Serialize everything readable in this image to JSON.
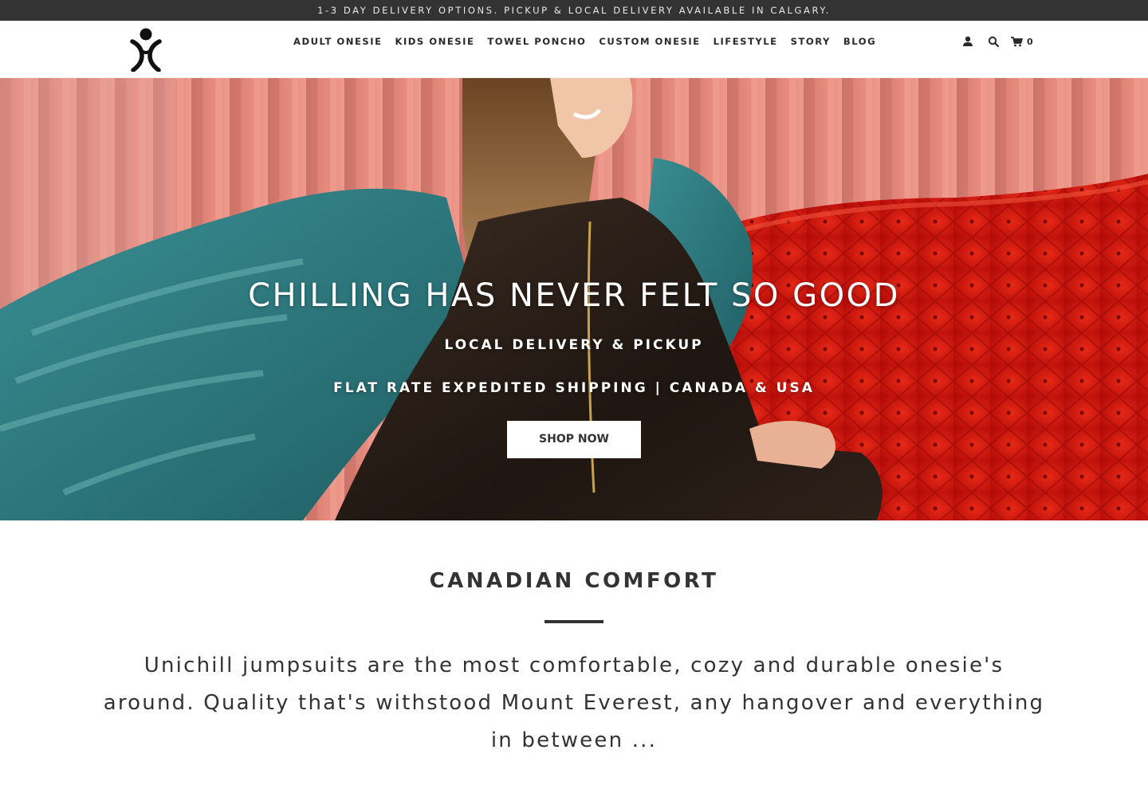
{
  "announcement": {
    "text": "1-3 DAY DELIVERY OPTIONS. PICKUP & LOCAL DELIVERY AVAILABLE IN CALGARY."
  },
  "header": {
    "logo_icon": "unichill-figure-logo",
    "nav": [
      {
        "label": "ADULT ONESIE"
      },
      {
        "label": "KIDS ONESIE"
      },
      {
        "label": "TOWEL PONCHO"
      },
      {
        "label": "CUSTOM ONESIE"
      },
      {
        "label": "LIFESTYLE"
      },
      {
        "label": "STORY"
      },
      {
        "label": "BLOG"
      }
    ],
    "icons": {
      "account": "user-icon",
      "search": "search-icon",
      "cart": "cart-icon"
    },
    "cart_count": "0"
  },
  "hero": {
    "title": "CHILLING HAS NEVER FELT SO GOOD",
    "subtitle_1": "LOCAL DELIVERY & PICKUP",
    "subtitle_2": "FLAT RATE EXPEDITED SHIPPING | CANADA & USA",
    "button_label": "SHOP NOW",
    "scroll_icon": "chevron-down-icon"
  },
  "intro": {
    "title": "CANADIAN COMFORT",
    "text": "Unichill jumpsuits are the most comfortable, cozy and durable onesie's around. Quality that's withstood Mount Everest, any hangover and everything in between ..."
  },
  "colors": {
    "announcement_bg": "#333333",
    "text": "#333333",
    "hero_curtain": "#e0867a",
    "hero_sofa": "#d81a10",
    "hero_blanket": "#2e7b80"
  }
}
